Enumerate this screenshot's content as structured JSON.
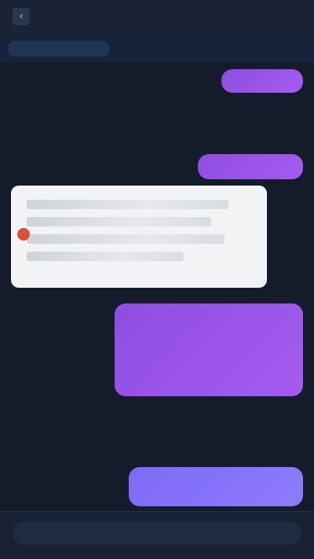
{
  "header": {
    "back_icon": "chevron-left-icon",
    "title": ""
  },
  "subheader": {
    "label": ""
  },
  "messages": [
    {
      "side": "out",
      "text": ""
    },
    {
      "side": "in",
      "text": ""
    },
    {
      "side": "out",
      "text": ""
    },
    {
      "side": "in_attachment",
      "text": ""
    },
    {
      "side": "out",
      "text": ""
    },
    {
      "side": "in",
      "text": ""
    },
    {
      "side": "out",
      "text": ""
    }
  ],
  "composer": {
    "placeholder": ""
  },
  "colors": {
    "background": "#141c2c",
    "bubble_purple": "#9b55ea",
    "bubble_violet": "#8675fb",
    "card": "#f2f3f5",
    "marker": "#d9503f"
  }
}
